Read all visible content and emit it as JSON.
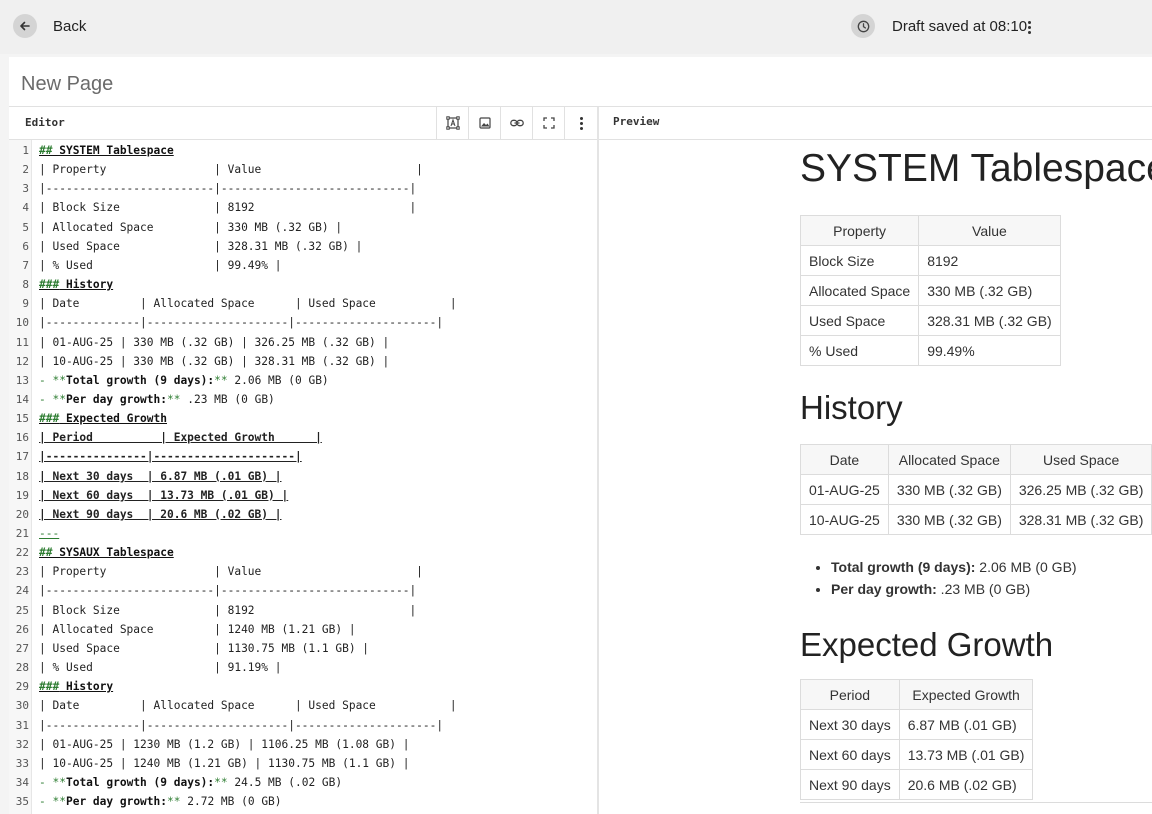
{
  "topbar": {
    "back_label": "Back",
    "draft_status": "Draft saved at 08:10"
  },
  "page": {
    "title": "New Page"
  },
  "editor": {
    "label": "Editor",
    "lines": [
      {
        "n": "1",
        "segs": [
          {
            "t": "##",
            "k": "mk"
          },
          {
            "t": " SYSTEM Tablespace"
          }
        ],
        "style": "hdr"
      },
      {
        "n": "2",
        "segs": [
          {
            "t": "| Property                | Value                       |"
          }
        ]
      },
      {
        "n": "3",
        "segs": [
          {
            "t": "|-------------------------|----------------------------|"
          }
        ]
      },
      {
        "n": "4",
        "segs": [
          {
            "t": "| Block Size              | 8192                       |"
          }
        ]
      },
      {
        "n": "5",
        "segs": [
          {
            "t": "| Allocated Space         | 330 MB (.32 GB) |"
          }
        ]
      },
      {
        "n": "6",
        "segs": [
          {
            "t": "| Used Space              | 328.31 MB (.32 GB) |"
          }
        ]
      },
      {
        "n": "7",
        "segs": [
          {
            "t": "| % Used                  | 99.49% |"
          }
        ]
      },
      {
        "n": "8",
        "segs": [
          {
            "t": "###",
            "k": "mk"
          },
          {
            "t": " History"
          }
        ],
        "style": "hdr"
      },
      {
        "n": "9",
        "segs": [
          {
            "t": "| Date         | Allocated Space      | Used Space           |"
          }
        ]
      },
      {
        "n": "10",
        "segs": [
          {
            "t": "|--------------|---------------------|---------------------|"
          }
        ]
      },
      {
        "n": "11",
        "segs": [
          {
            "t": "| 01-AUG-25 | 330 MB (.32 GB) | 326.25 MB (.32 GB) |"
          }
        ]
      },
      {
        "n": "12",
        "segs": [
          {
            "t": "| 10-AUG-25 | 330 MB (.32 GB) | 328.31 MB (.32 GB) |"
          }
        ]
      },
      {
        "n": "13",
        "segs": [
          {
            "t": "- ",
            "k": "mk"
          },
          {
            "t": "**",
            "k": "mk"
          },
          {
            "t": "Total growth (9 days):",
            "k": "b"
          },
          {
            "t": "**",
            "k": "mk"
          },
          {
            "t": " 2.06 MB (0 GB)"
          }
        ]
      },
      {
        "n": "14",
        "segs": [
          {
            "t": "- ",
            "k": "mk"
          },
          {
            "t": "**",
            "k": "mk"
          },
          {
            "t": "Per day growth:",
            "k": "b"
          },
          {
            "t": "**",
            "k": "mk"
          },
          {
            "t": " .23 MB (0 GB)"
          }
        ]
      },
      {
        "n": "15",
        "segs": [
          {
            "t": "###",
            "k": "mk"
          },
          {
            "t": " Expected Growth"
          }
        ],
        "style": "hdr"
      },
      {
        "n": "16",
        "segs": [
          {
            "t": "| Period          | Expected Growth      |"
          }
        ],
        "style": "ul"
      },
      {
        "n": "17",
        "segs": [
          {
            "t": "|---------------|---------------------|"
          }
        ],
        "style": "ul"
      },
      {
        "n": "18",
        "segs": [
          {
            "t": "| Next 30 days  | 6.87 MB (.01 GB) |"
          }
        ],
        "style": "ul"
      },
      {
        "n": "19",
        "segs": [
          {
            "t": "| Next 60 days  | 13.73 MB (.01 GB) |"
          }
        ],
        "style": "ul"
      },
      {
        "n": "20",
        "segs": [
          {
            "t": "| Next 90 days  | 20.6 MB (.02 GB) |"
          }
        ],
        "style": "ul"
      },
      {
        "n": "21",
        "segs": [
          {
            "t": "---"
          }
        ],
        "style": "hr"
      },
      {
        "n": "22",
        "segs": [
          {
            "t": "##",
            "k": "mk"
          },
          {
            "t": " SYSAUX Tablespace"
          }
        ],
        "style": "hdr"
      },
      {
        "n": "23",
        "segs": [
          {
            "t": "| Property                | Value                       |"
          }
        ]
      },
      {
        "n": "24",
        "segs": [
          {
            "t": "|-------------------------|----------------------------|"
          }
        ]
      },
      {
        "n": "25",
        "segs": [
          {
            "t": "| Block Size              | 8192                       |"
          }
        ]
      },
      {
        "n": "26",
        "segs": [
          {
            "t": "| Allocated Space         | 1240 MB (1.21 GB) |"
          }
        ]
      },
      {
        "n": "27",
        "segs": [
          {
            "t": "| Used Space              | 1130.75 MB (1.1 GB) |"
          }
        ]
      },
      {
        "n": "28",
        "segs": [
          {
            "t": "| % Used                  | 91.19% |"
          }
        ]
      },
      {
        "n": "29",
        "segs": [
          {
            "t": "###",
            "k": "mk"
          },
          {
            "t": " History"
          }
        ],
        "style": "hdr"
      },
      {
        "n": "30",
        "segs": [
          {
            "t": "| Date         | Allocated Space      | Used Space           |"
          }
        ]
      },
      {
        "n": "31",
        "segs": [
          {
            "t": "|--------------|---------------------|---------------------|"
          }
        ]
      },
      {
        "n": "32",
        "segs": [
          {
            "t": "| 01-AUG-25 | 1230 MB (1.2 GB) | 1106.25 MB (1.08 GB) |"
          }
        ]
      },
      {
        "n": "33",
        "segs": [
          {
            "t": "| 10-AUG-25 | 1240 MB (1.21 GB) | 1130.75 MB (1.1 GB) |"
          }
        ]
      },
      {
        "n": "34",
        "segs": [
          {
            "t": "- ",
            "k": "mk"
          },
          {
            "t": "**",
            "k": "mk"
          },
          {
            "t": "Total growth (9 days):",
            "k": "b"
          },
          {
            "t": "**",
            "k": "mk"
          },
          {
            "t": " 24.5 MB (.02 GB)"
          }
        ]
      },
      {
        "n": "35",
        "segs": [
          {
            "t": "- ",
            "k": "mk"
          },
          {
            "t": "**",
            "k": "mk"
          },
          {
            "t": "Per day growth:",
            "k": "b"
          },
          {
            "t": "**",
            "k": "mk"
          },
          {
            "t": " 2.72 MB (0 GB)"
          }
        ]
      }
    ]
  },
  "preview": {
    "label": "Preview",
    "h1": "SYSTEM Tablespace",
    "table1": {
      "headers": [
        "Property",
        "Value"
      ],
      "rows": [
        [
          "Block Size",
          "8192"
        ],
        [
          "Allocated Space",
          "330 MB (.32 GB)"
        ],
        [
          "Used Space",
          "328.31 MB (.32 GB)"
        ],
        [
          "% Used",
          "99.49%"
        ]
      ]
    },
    "h_history": "History",
    "table2": {
      "headers": [
        "Date",
        "Allocated Space",
        "Used Space"
      ],
      "rows": [
        [
          "01-AUG-25",
          "330 MB (.32 GB)",
          "326.25 MB (.32 GB)"
        ],
        [
          "10-AUG-25",
          "330 MB (.32 GB)",
          "328.31 MB (.32 GB)"
        ]
      ]
    },
    "growth": [
      {
        "label": "Total growth (9 days):",
        "value": " 2.06 MB (0 GB)"
      },
      {
        "label": "Per day growth:",
        "value": " .23 MB (0 GB)"
      }
    ],
    "h_expected": "Expected Growth",
    "table3": {
      "headers": [
        "Period",
        "Expected Growth"
      ],
      "rows": [
        [
          "Next 30 days",
          "6.87 MB (.01 GB)"
        ],
        [
          "Next 60 days",
          "13.73 MB (.01 GB)"
        ],
        [
          "Next 90 days",
          "20.6 MB (.02 GB)"
        ]
      ]
    }
  },
  "icons": {
    "back": "arrow-left-icon",
    "status": "clock-icon",
    "more": "more-vertical-icon",
    "toolbar": [
      "diagram-icon",
      "image-icon",
      "link-icon",
      "fullscreen-icon",
      "more-vertical-icon"
    ]
  },
  "colors": {
    "markdown_marker": "#2e7d32",
    "icon_circle": "#d4d4d4",
    "table_border": "#dcdcdc"
  }
}
